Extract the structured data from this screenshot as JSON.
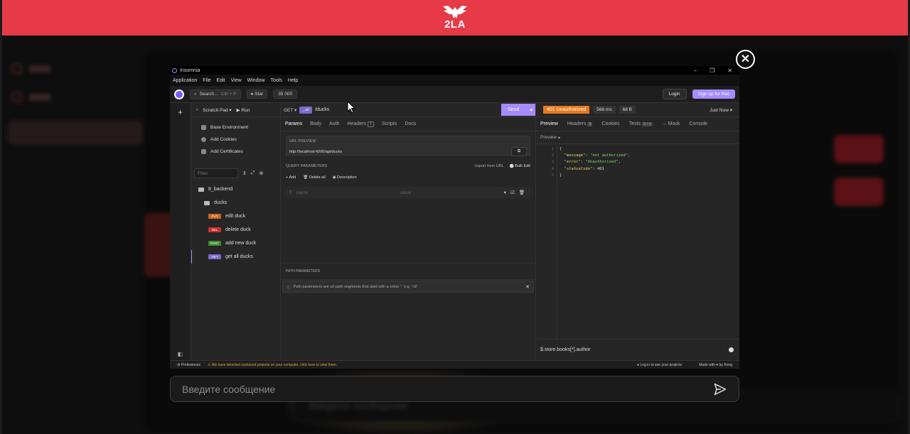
{
  "header": {
    "logo_text": "2LA",
    "brand_color": "#e63a47"
  },
  "background": {
    "input_placeholder": "Введите сообщение"
  },
  "modal": {
    "close_icon": "close-icon"
  },
  "insomnia": {
    "window_title": "Insomnia",
    "menu": [
      "Application",
      "File",
      "Edit",
      "View",
      "Window",
      "Tools",
      "Help"
    ],
    "toolbar": {
      "search": "Search...",
      "search_kbd": "Ctrl + P",
      "star": "Star",
      "star_count": "35 000",
      "login": "Login",
      "signup": "Sign up for free"
    },
    "sidebar": {
      "scratch": "Scratch Pad",
      "run": "Run",
      "items": [
        "Base Environment",
        "Add Cookies",
        "Add Certificates"
      ],
      "filter_placeholder": "Filter",
      "collection": "8_backend",
      "folder": "ducks",
      "requests": [
        {
          "method": "PUT",
          "name": "edit duck"
        },
        {
          "method": "DEL",
          "name": "delete duck"
        },
        {
          "method": "POST",
          "name": "add new duck"
        },
        {
          "method": "GET",
          "name": "get all ducks"
        }
      ]
    },
    "request": {
      "method": "GET",
      "url_chip": "_.url",
      "url_path": "/ducks",
      "send": "Send",
      "tabs": [
        "Params",
        "Body",
        "Auth",
        "Headers",
        "Scripts",
        "Docs"
      ],
      "headers_count": "1",
      "url_preview_label": "URL PREVIEW",
      "url_preview": "http://localhost:4200/api/ducks",
      "query_label": "QUERY PARAMETERS",
      "import_from_url": "Import from URL",
      "bulk_edit": "Bulk Edit",
      "add": "Add",
      "delete_all": "Delete all",
      "description": "Description",
      "name_placeholder": "name",
      "value_placeholder": "value",
      "path_label": "PATH PARAMETERS",
      "path_note": "Path parameters are url path segments that start with a colon ':' e.g. ':id'"
    },
    "response": {
      "status": "401 Unauthorized",
      "time": "566 ms",
      "size": "68 B",
      "when": "Just Now",
      "tabs": [
        "Preview",
        "Headers",
        "Cookies",
        "Tests",
        "→ Mock",
        "Console"
      ],
      "headers_count": "8",
      "tests_count": "0 / 0",
      "preview_select": "Preview",
      "line_numbers": [
        "1",
        "2",
        "3",
        "4",
        "5"
      ],
      "json": {
        "message_key": "\"message\"",
        "message_val": "\"not authorized\"",
        "error_key": "\"error\"",
        "error_val": "\"Unauthorized\"",
        "status_key": "\"statusCode\"",
        "status_val": "401"
      },
      "json_path": "$.store.books[*].author"
    },
    "statusbar": {
      "preferences": "Preferences",
      "warning": "We have detected orphaned projects on your computer, click here to view them.",
      "login_note": "Log in to see your projects",
      "made_with": "Made with ♥ by Kong"
    }
  }
}
